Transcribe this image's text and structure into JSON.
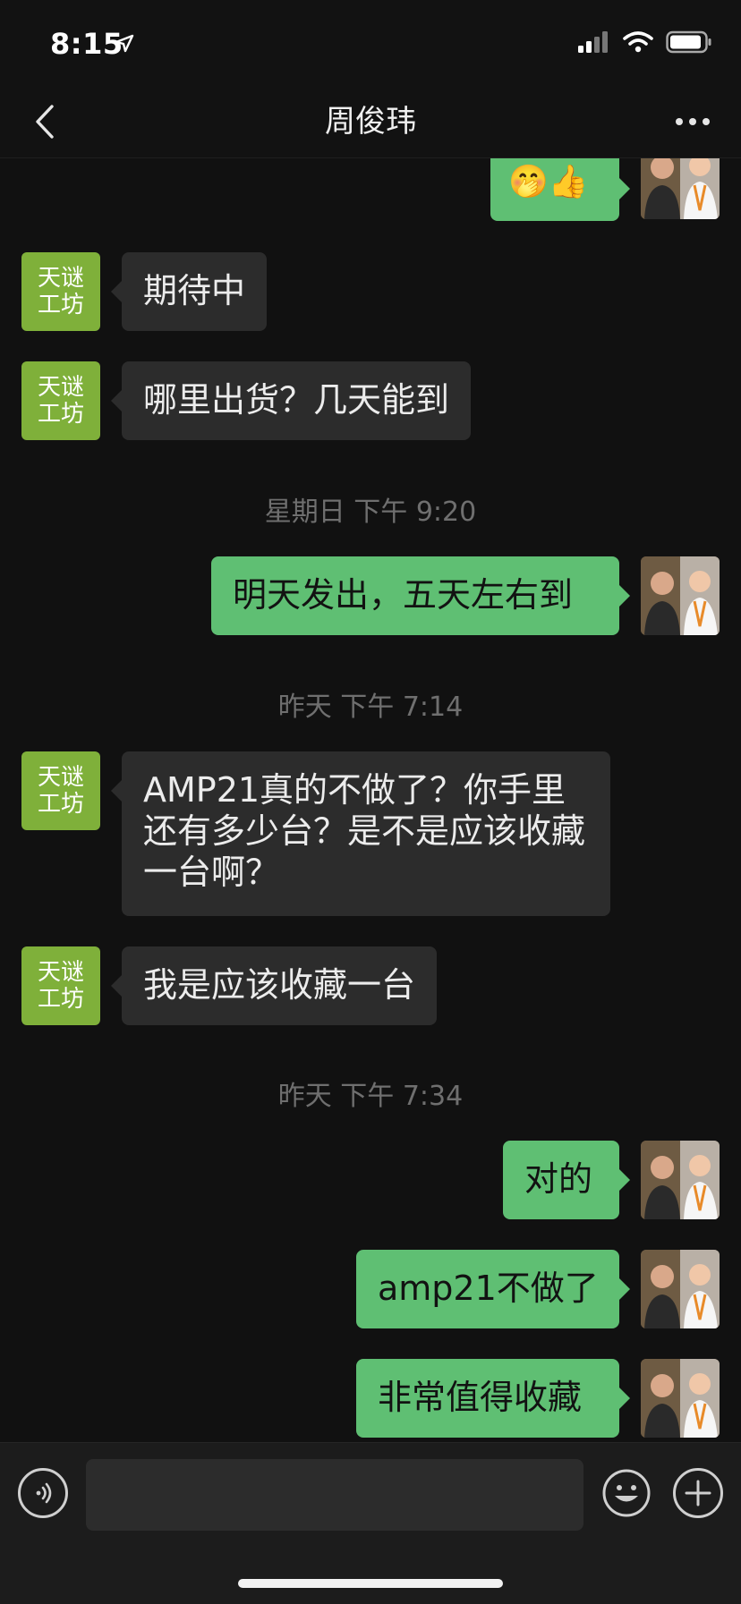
{
  "status_bar": {
    "time": "8:15",
    "icons": [
      "location-arrow-icon",
      "signal-icon",
      "wifi-icon",
      "battery-icon"
    ]
  },
  "nav": {
    "title": "周俊玮",
    "back_icon": "chevron-left-icon",
    "more_icon": "more-dots-icon"
  },
  "contact_avatar": {
    "logo_line1": "天谜",
    "logo_line2": "工坊",
    "color": "#7fb03a"
  },
  "timestamps": {
    "t1": "星期日 下午 9:20",
    "t2": "昨天 下午 7:14",
    "t3": "昨天 下午 7:34"
  },
  "messages": {
    "m0": "🤭👍",
    "m1": "期待中",
    "m2": "哪里出货？几天能到",
    "m3": "明天发出，五天左右到",
    "m4": "AMP21真的不做了？你手里还有多少台？是不是应该收藏一台啊？",
    "m5": "我是应该收藏一台",
    "m6": "对的",
    "m7": "amp21不做了",
    "m8": "非常值得收藏"
  },
  "input_bar": {
    "placeholder": "",
    "icons": [
      "voice-icon",
      "emoji-icon",
      "plus-icon"
    ]
  },
  "colors": {
    "background": "#111111",
    "bubble_received": "#2c2c2c",
    "bubble_sent": "#5fbf73",
    "timestamp": "#6f6f6f"
  }
}
